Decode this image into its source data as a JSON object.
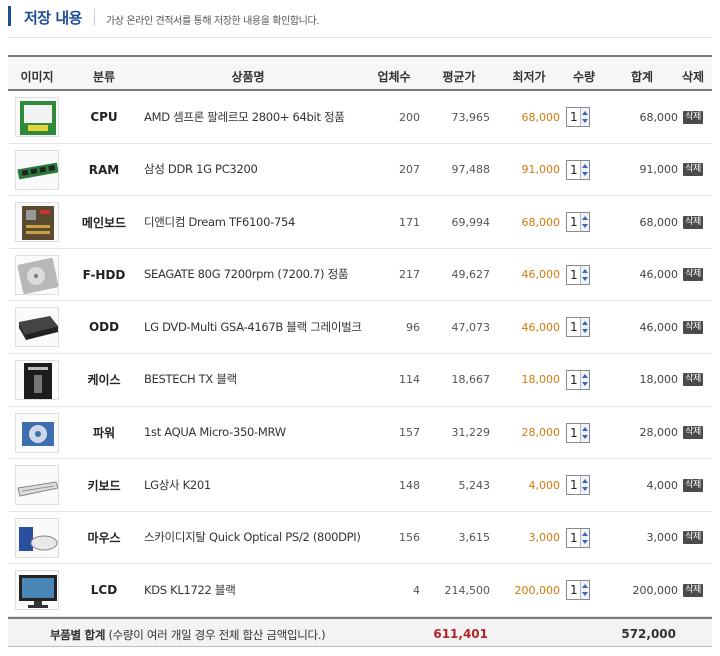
{
  "header": {
    "title": "저장 내용",
    "description": "가상 온라인 견적서를 통해 저장한 내용을 확인합니다."
  },
  "columns": {
    "image": "이미지",
    "category": "분류",
    "product": "상품명",
    "shops": "업체수",
    "avg_price": "평균가",
    "min_price": "최저가",
    "qty": "수량",
    "total": "합계",
    "delete": "삭제"
  },
  "rows": [
    {
      "category": "CPU",
      "product": "AMD 셈프론 팔레르모 2800+ 64bit 정품",
      "shops": "200",
      "avg": "73,965",
      "min": "68,000",
      "qty": "1",
      "total": "68,000",
      "delete_label": "삭제",
      "thumb": "cpu-box"
    },
    {
      "category": "RAM",
      "product": "삼성 DDR 1G PC3200",
      "shops": "207",
      "avg": "97,488",
      "min": "91,000",
      "qty": "1",
      "total": "91,000",
      "delete_label": "삭제",
      "thumb": "ram-stick"
    },
    {
      "category": "메인보드",
      "product": "디앤디컴 Dream TF6100-754",
      "shops": "171",
      "avg": "69,994",
      "min": "68,000",
      "qty": "1",
      "total": "68,000",
      "delete_label": "삭제",
      "thumb": "mainboard"
    },
    {
      "category": "F-HDD",
      "product": "SEAGATE 80G 7200rpm (7200.7) 정품",
      "shops": "217",
      "avg": "49,627",
      "min": "46,000",
      "qty": "1",
      "total": "46,000",
      "delete_label": "삭제",
      "thumb": "hard-disk"
    },
    {
      "category": "ODD",
      "product": "LG DVD-Multi GSA-4167B 블랙 그레이벌크",
      "shops": "96",
      "avg": "47,073",
      "min": "46,000",
      "qty": "1",
      "total": "46,000",
      "delete_label": "삭제",
      "thumb": "optical-drive"
    },
    {
      "category": "케이스",
      "product": "BESTECH TX 블랙",
      "shops": "114",
      "avg": "18,667",
      "min": "18,000",
      "qty": "1",
      "total": "18,000",
      "delete_label": "삭제",
      "thumb": "pc-case"
    },
    {
      "category": "파워",
      "product": "1st AQUA Micro-350-MRW",
      "shops": "157",
      "avg": "31,229",
      "min": "28,000",
      "qty": "1",
      "total": "28,000",
      "delete_label": "삭제",
      "thumb": "power-supply"
    },
    {
      "category": "키보드",
      "product": "LG상사 K201",
      "shops": "148",
      "avg": "5,243",
      "min": "4,000",
      "qty": "1",
      "total": "4,000",
      "delete_label": "삭제",
      "thumb": "keyboard"
    },
    {
      "category": "마우스",
      "product": "스카이디지탈 Quick Optical PS/2 (800DPI)",
      "shops": "156",
      "avg": "3,615",
      "min": "3,000",
      "qty": "1",
      "total": "3,000",
      "delete_label": "삭제",
      "thumb": "mouse"
    },
    {
      "category": "LCD",
      "product": "KDS KL1722 블랙",
      "shops": "4",
      "avg": "214,500",
      "min": "200,000",
      "qty": "1",
      "total": "200,000",
      "delete_label": "삭제",
      "thumb": "lcd-monitor"
    }
  ],
  "footer": {
    "label_bold": "부품별 합계",
    "label_note": " (수량이 여러 개일 경우 전체 합산 금액입니다.)",
    "avg_sum": "611,401",
    "total_sum": "572,000"
  },
  "colors": {
    "title": "#1f4e99",
    "min_price": "#d07a0e",
    "avg_sum": "#b0242c",
    "delete_button": "#4b4b4b"
  }
}
